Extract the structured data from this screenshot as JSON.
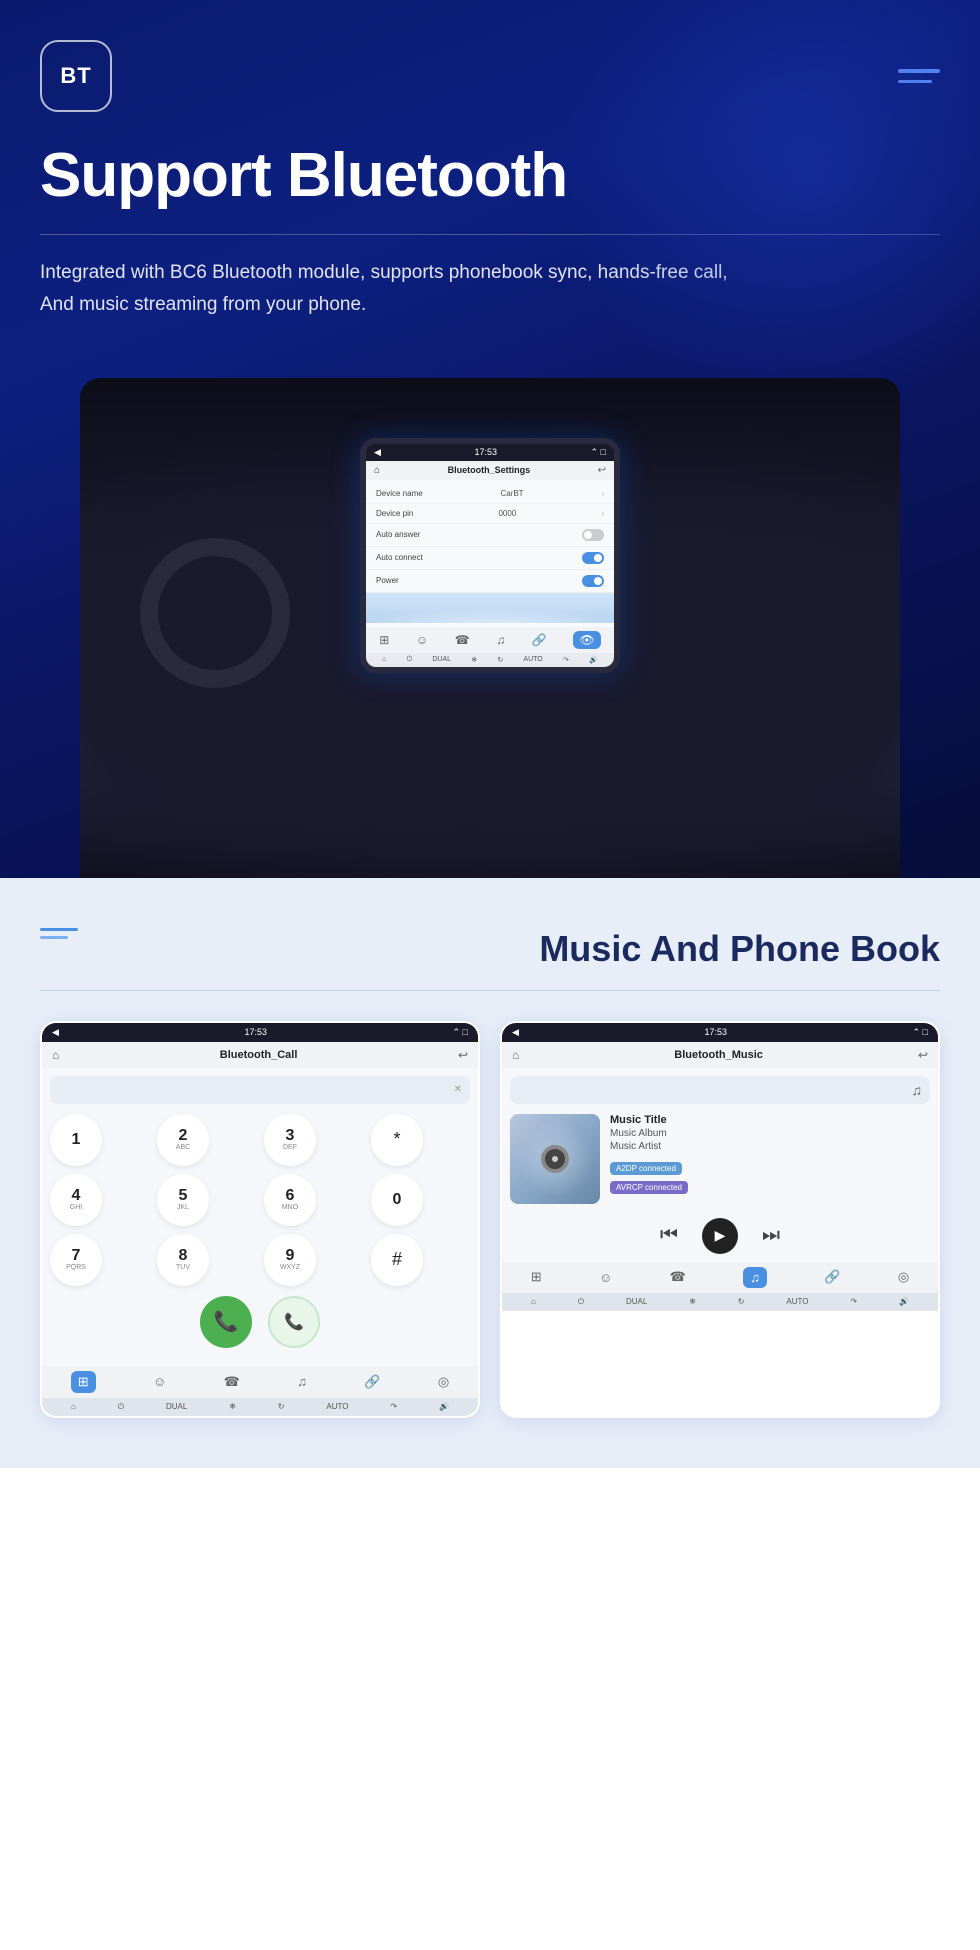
{
  "hero": {
    "bt_logo": "BT",
    "title": "Support Bluetooth",
    "description_line1": "Integrated with BC6 Bluetooth module, supports phonebook sync, hands-free call,",
    "description_line2": "And music streaming from your phone.",
    "display": {
      "status_bar": {
        "time": "17:53",
        "icons": "⌃ ⌄ □"
      },
      "nav": {
        "home_icon": "⌂",
        "title": "Bluetooth_Settings",
        "back_icon": "↩"
      },
      "rows": [
        {
          "label": "Device name",
          "value": "CarBT",
          "type": "arrow"
        },
        {
          "label": "Device pin",
          "value": "0000",
          "type": "arrow"
        },
        {
          "label": "Auto answer",
          "value": "",
          "type": "toggle_off"
        },
        {
          "label": "Auto connect",
          "value": "",
          "type": "toggle_on"
        },
        {
          "label": "Power",
          "value": "",
          "type": "toggle_on"
        }
      ],
      "bottom_icons": [
        "⊞",
        "☺",
        "☎",
        "♫",
        "🔗",
        "👁"
      ],
      "active_bottom": 5,
      "ac_items": [
        "⌂",
        "⏻",
        "DUAL",
        "❄",
        "↻",
        "AUTO",
        "↷",
        "🔊"
      ]
    }
  },
  "bottom": {
    "title": "Music And Phone Book",
    "call_screen": {
      "status_time": "17:53",
      "nav_title": "Bluetooth_Call",
      "keypad": [
        {
          "main": "1",
          "sub": ""
        },
        {
          "main": "2",
          "sub": "ABC"
        },
        {
          "main": "3",
          "sub": "DEF"
        },
        {
          "main": "*",
          "sub": ""
        },
        {
          "main": "4",
          "sub": "GHI"
        },
        {
          "main": "5",
          "sub": "JKL"
        },
        {
          "main": "6",
          "sub": "MNO"
        },
        {
          "main": "0",
          "sub": ""
        },
        {
          "main": "7",
          "sub": "PQRS"
        },
        {
          "main": "8",
          "sub": "TUV"
        },
        {
          "main": "9",
          "sub": "WXYZ"
        },
        {
          "main": "#",
          "sub": ""
        }
      ],
      "bottom_icons": [
        "⊞",
        "☺",
        "☎",
        "♫",
        "🔗",
        "◎"
      ],
      "active_bottom": 0,
      "ac_items": [
        "⌂",
        "⏻",
        "DUAL",
        "❄",
        "↻",
        "AUTO",
        "↷",
        "🔊"
      ]
    },
    "music_screen": {
      "status_time": "17:53",
      "nav_title": "Bluetooth_Music",
      "music_title": "Music Title",
      "music_album": "Music Album",
      "music_artist": "Music Artist",
      "badge_a2dp": "A2DP connected",
      "badge_avrcp": "AVRCP connected",
      "bottom_icons": [
        "⊞",
        "☺",
        "☎",
        "♫",
        "🔗",
        "◎"
      ],
      "active_bottom": 3,
      "ac_items": [
        "⌂",
        "⏻",
        "DUAL",
        "❄",
        "↻",
        "AUTO",
        "↷",
        "🔊"
      ]
    }
  }
}
